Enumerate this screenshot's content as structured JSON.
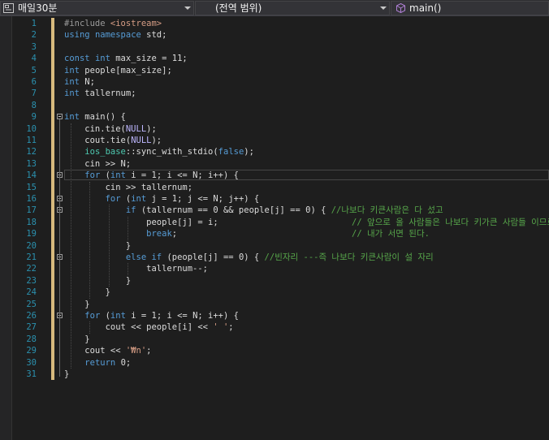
{
  "navigation_bar": {
    "project": "매일30분",
    "scope": "(전역 범위)",
    "member": "main()"
  },
  "colors": {
    "keyword": "#569cd6",
    "type": "#4ec9b0",
    "macro": "#beb7ff",
    "string": "#d69d85",
    "comment": "#57a64a",
    "preprocessor": "#9b9b9b",
    "default": "#dcdcdc",
    "line_number": "#2b91af",
    "change_marker": "#d7ba7d"
  },
  "editor": {
    "current_line": 14,
    "lines": [
      {
        "n": "1",
        "tokens": [
          [
            "#include ",
            "preprocessor"
          ],
          [
            "<iostream>",
            "string"
          ]
        ]
      },
      {
        "n": "2",
        "tokens": [
          [
            "using ",
            "keyword"
          ],
          [
            "namespace ",
            "keyword"
          ],
          [
            "std;",
            "default"
          ]
        ]
      },
      {
        "n": "3",
        "tokens": []
      },
      {
        "n": "4",
        "tokens": [
          [
            "const ",
            "keyword"
          ],
          [
            "int ",
            "keyword"
          ],
          [
            "max_size = 11;",
            "default"
          ]
        ]
      },
      {
        "n": "5",
        "tokens": [
          [
            "int ",
            "keyword"
          ],
          [
            "people[max_size];",
            "default"
          ]
        ]
      },
      {
        "n": "6",
        "tokens": [
          [
            "int ",
            "keyword"
          ],
          [
            "N;",
            "default"
          ]
        ]
      },
      {
        "n": "7",
        "tokens": [
          [
            "int ",
            "keyword"
          ],
          [
            "tallernum;",
            "default"
          ]
        ]
      },
      {
        "n": "8",
        "tokens": []
      },
      {
        "n": "9",
        "tokens": [
          [
            "int ",
            "keyword"
          ],
          [
            "main() {",
            "default"
          ]
        ]
      },
      {
        "n": "10",
        "tokens": [
          [
            "    cin.tie(",
            "default"
          ],
          [
            "NULL",
            "macro"
          ],
          [
            ");",
            "default"
          ]
        ]
      },
      {
        "n": "11",
        "tokens": [
          [
            "    cout.tie(",
            "default"
          ],
          [
            "NULL",
            "macro"
          ],
          [
            ");",
            "default"
          ]
        ]
      },
      {
        "n": "12",
        "tokens": [
          [
            "    ",
            "default"
          ],
          [
            "ios_base",
            "type"
          ],
          [
            "::sync_with_stdio(",
            "default"
          ],
          [
            "false",
            "keyword"
          ],
          [
            ");",
            "default"
          ]
        ]
      },
      {
        "n": "13",
        "tokens": [
          [
            "    cin >> N;",
            "default"
          ]
        ]
      },
      {
        "n": "14",
        "tokens": [
          [
            "    ",
            "default"
          ],
          [
            "for ",
            "keyword"
          ],
          [
            "(",
            "default"
          ],
          [
            "int ",
            "keyword"
          ],
          [
            "i = 1; i <= N; i++) {",
            "default"
          ]
        ]
      },
      {
        "n": "15",
        "tokens": [
          [
            "        cin >> tallernum;",
            "default"
          ]
        ]
      },
      {
        "n": "16",
        "tokens": [
          [
            "        ",
            "default"
          ],
          [
            "for ",
            "keyword"
          ],
          [
            "(",
            "default"
          ],
          [
            "int ",
            "keyword"
          ],
          [
            "j = 1; j <= N; j++) {",
            "default"
          ]
        ]
      },
      {
        "n": "17",
        "tokens": [
          [
            "            ",
            "default"
          ],
          [
            "if ",
            "keyword"
          ],
          [
            "(tallernum == 0 && people[j] == 0) { ",
            "default"
          ],
          [
            "//나보다 키큰사람은 다 섰고",
            "comment"
          ]
        ]
      },
      {
        "n": "18",
        "tokens": [
          [
            "                people[j] = i;                          ",
            "default"
          ],
          [
            "// 앞으로 올 사람들은 나보다 키가큰 사람들 이므로",
            "comment"
          ]
        ]
      },
      {
        "n": "19",
        "tokens": [
          [
            "                ",
            "default"
          ],
          [
            "break",
            "keyword"
          ],
          [
            ";                                  ",
            "default"
          ],
          [
            "// 내가 서면 된다.",
            "comment"
          ]
        ]
      },
      {
        "n": "20",
        "tokens": [
          [
            "            }",
            "default"
          ]
        ]
      },
      {
        "n": "21",
        "tokens": [
          [
            "            ",
            "default"
          ],
          [
            "else ",
            "keyword"
          ],
          [
            "if ",
            "keyword"
          ],
          [
            "(people[j] == 0) { ",
            "default"
          ],
          [
            "//빈자리 ---즉 나보다 키큰사람이 설 자리",
            "comment"
          ]
        ]
      },
      {
        "n": "22",
        "tokens": [
          [
            "                tallernum--;",
            "default"
          ]
        ]
      },
      {
        "n": "23",
        "tokens": [
          [
            "            }",
            "default"
          ]
        ]
      },
      {
        "n": "24",
        "tokens": [
          [
            "        }",
            "default"
          ]
        ]
      },
      {
        "n": "25",
        "tokens": [
          [
            "    }",
            "default"
          ]
        ]
      },
      {
        "n": "26",
        "tokens": [
          [
            "    ",
            "default"
          ],
          [
            "for ",
            "keyword"
          ],
          [
            "(",
            "default"
          ],
          [
            "int ",
            "keyword"
          ],
          [
            "i = 1; i <= N; i++) {",
            "default"
          ]
        ]
      },
      {
        "n": "27",
        "tokens": [
          [
            "        cout << people[i] << ",
            "default"
          ],
          [
            "' '",
            "string"
          ],
          [
            ";",
            "default"
          ]
        ]
      },
      {
        "n": "28",
        "tokens": [
          [
            "    }",
            "default"
          ]
        ]
      },
      {
        "n": "29",
        "tokens": [
          [
            "    cout << ",
            "default"
          ],
          [
            "'₩n'",
            "string"
          ],
          [
            ";",
            "default"
          ]
        ]
      },
      {
        "n": "30",
        "tokens": [
          [
            "    ",
            "default"
          ],
          [
            "return ",
            "keyword"
          ],
          [
            "0;",
            "default"
          ]
        ]
      },
      {
        "n": "31",
        "tokens": [
          [
            "}",
            "default"
          ]
        ]
      }
    ],
    "foldable_lines": [
      9,
      14,
      16,
      17,
      21,
      26
    ]
  }
}
